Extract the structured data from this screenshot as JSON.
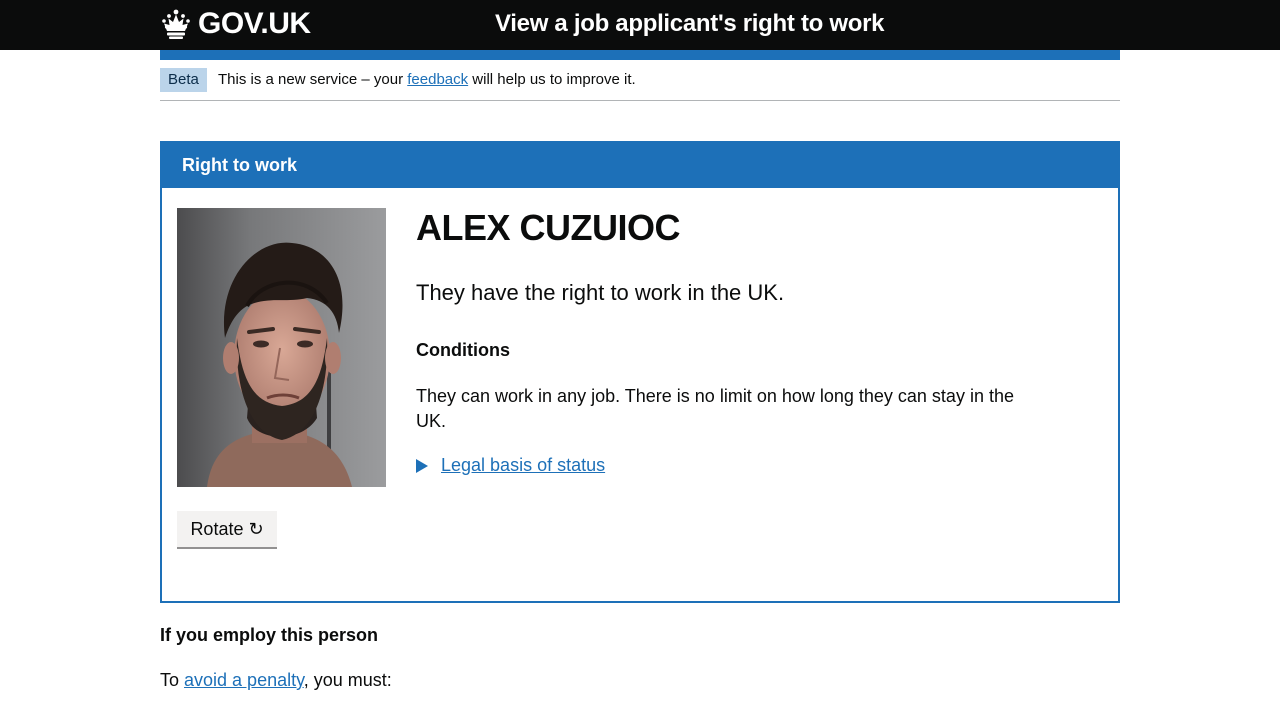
{
  "header": {
    "logo_text": "GOV.UK",
    "service_name": "View a job applicant's right to work"
  },
  "phase_banner": {
    "tag": "Beta",
    "text_before": "This is a new service – your ",
    "link": "feedback",
    "text_after": " will help us to improve it."
  },
  "panel": {
    "title": "Right to work",
    "name": "ALEX CUZUIOC",
    "status": "They have the right to work in the UK.",
    "conditions_heading": "Conditions",
    "conditions_text": "They can work in any job. There is no limit on how long they can stay in the UK.",
    "details_summary": "Legal basis of status",
    "rotate_button": "Rotate ↻"
  },
  "employ": {
    "heading": "If you employ this person",
    "text_before": "To ",
    "link": "avoid a penalty",
    "text_after": ", you must:"
  },
  "colors": {
    "header_bg": "#0b0c0c",
    "brand_blue": "#1d70b8",
    "beta_tag_bg": "#bbd4ea"
  }
}
